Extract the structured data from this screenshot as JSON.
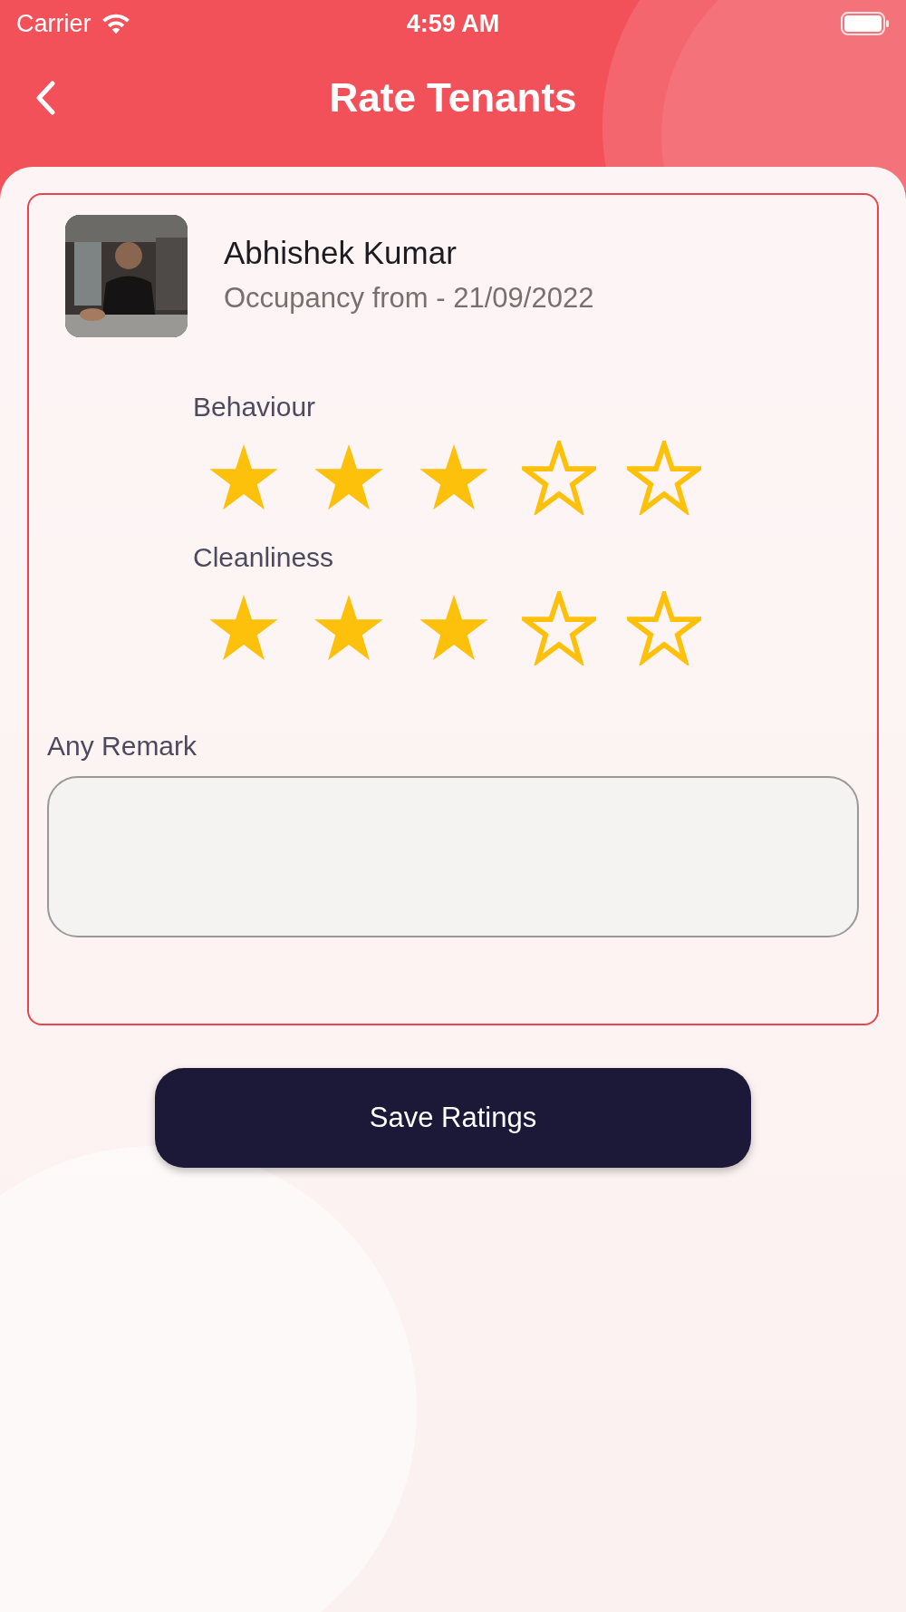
{
  "status_bar": {
    "carrier": "Carrier",
    "time": "4:59 AM"
  },
  "header": {
    "title": "Rate Tenants"
  },
  "tenant": {
    "name": "Abhishek Kumar",
    "occupancy": "Occupancy from - 21/09/2022"
  },
  "ratings": [
    {
      "label": "Behaviour",
      "stars": 3
    },
    {
      "label": "Cleanliness",
      "stars": 3
    }
  ],
  "remark": {
    "label": "Any Remark"
  },
  "save_button": {
    "label": "Save Ratings"
  }
}
